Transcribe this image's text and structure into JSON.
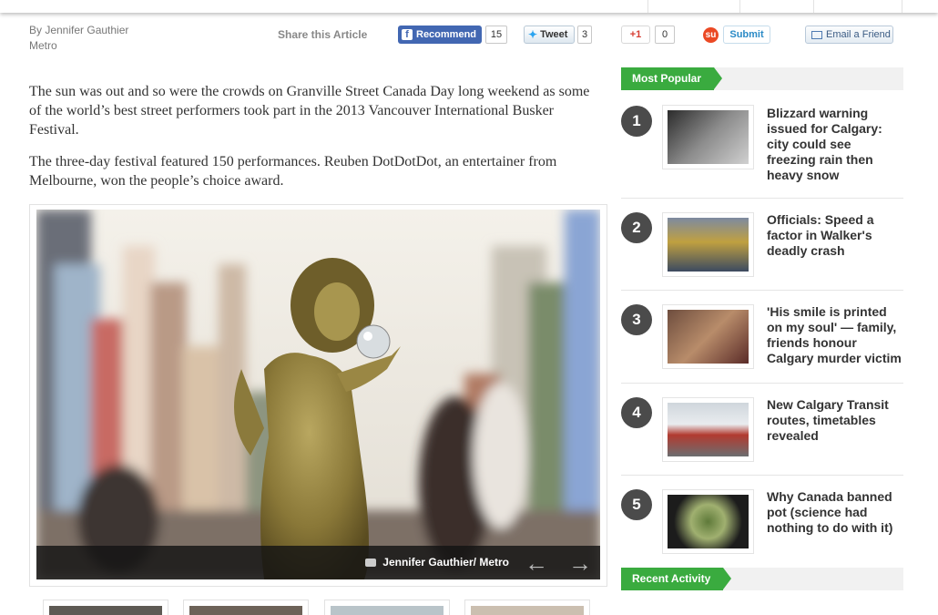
{
  "byline": {
    "author": "By Jennifer Gauthier",
    "source": "Metro"
  },
  "share": {
    "label": "Share this Article",
    "recommend_label": "Recommend",
    "recommend_count": "15",
    "tweet_label": "Tweet",
    "tweet_count": "3",
    "gplus_label": "+1",
    "gplus_count": "0",
    "submit_label": "Submit",
    "email_label": "Email a Friend"
  },
  "article": {
    "paragraphs": [
      "The sun was out and so were the crowds on Granville Street Canada Day long weekend as some of the world’s best street performers took part in the 2013 Vancouver International Busker Festival.",
      "The three-day festival featured 150 performances. Reuben DotDotDot, an entertainer from Melbourne, won the people’s choice award."
    ],
    "photo_credit": "Jennifer Gauthier/ Metro"
  },
  "sidebar": {
    "most_popular_label": "Most Popular",
    "recent_activity_label": "Recent Activity",
    "items": [
      {
        "rank": "1",
        "title": "Blizzard warning issued for Calgary: city could see freezing rain then heavy snow"
      },
      {
        "rank": "2",
        "title": "Officials: Speed a factor in Walker's deadly crash"
      },
      {
        "rank": "3",
        "title": "'His smile is printed on my soul' — family, friends honour Calgary murder victim"
      },
      {
        "rank": "4",
        "title": "New Calgary Transit routes, timetables revealed"
      },
      {
        "rank": "5",
        "title": "Why Canada banned pot (science had nothing to do with it)"
      }
    ]
  },
  "colors": {
    "accent_green": "#3aab3f",
    "facebook_blue": "#4267b2",
    "rank_circle": "#4b4b4b"
  }
}
